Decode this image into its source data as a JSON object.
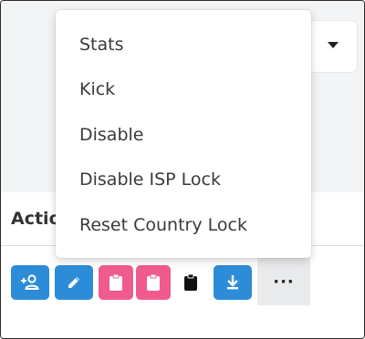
{
  "table": {
    "header_label": "Actio"
  },
  "actions": [
    {
      "name": "add-user",
      "icon": "add-user-icon",
      "color": "#2d8cd8"
    },
    {
      "name": "edit",
      "icon": "pencil-icon",
      "color": "#2d8cd8"
    },
    {
      "name": "clipboard-1",
      "icon": "clipboard-icon",
      "color": "#ef5b8c"
    },
    {
      "name": "clipboard-2",
      "icon": "clipboard-icon",
      "color": "#ef5b8c"
    },
    {
      "name": "clipboard-3",
      "icon": "clipboard-icon",
      "color": "none"
    },
    {
      "name": "download",
      "icon": "download-icon",
      "color": "#2d8cd8"
    }
  ],
  "more_button": {
    "label": "···"
  },
  "context_menu": {
    "items": [
      {
        "label": "Stats"
      },
      {
        "label": "Kick"
      },
      {
        "label": "Disable"
      },
      {
        "label": "Disable ISP Lock"
      },
      {
        "label": "Reset Country Lock"
      }
    ]
  }
}
